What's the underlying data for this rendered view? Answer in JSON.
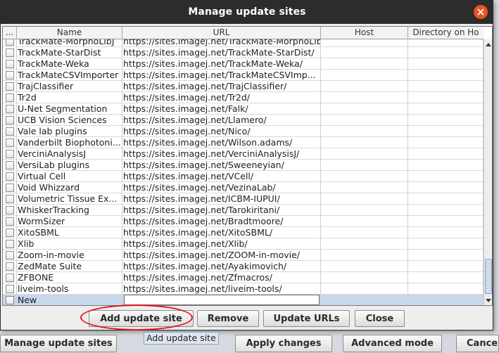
{
  "dialog": {
    "title": "Manage update sites",
    "close_icon": "close-icon"
  },
  "table": {
    "columns": [
      {
        "key": "check",
        "label": "..."
      },
      {
        "key": "name",
        "label": "Name"
      },
      {
        "key": "url",
        "label": "URL"
      },
      {
        "key": "host",
        "label": "Host"
      },
      {
        "key": "dir",
        "label": "Directory on Ho"
      }
    ],
    "rows": [
      {
        "checked": false,
        "name": "TrackMate-MorphoLibJ",
        "url": "https://sites.imagej.net/TrackMate-MorphoLibJ/",
        "host": "",
        "dir": ""
      },
      {
        "checked": false,
        "name": "TrackMate-StarDist",
        "url": "https://sites.imagej.net/TrackMate-StarDist/",
        "host": "",
        "dir": ""
      },
      {
        "checked": false,
        "name": "TrackMate-Weka",
        "url": "https://sites.imagej.net/TrackMate-Weka/",
        "host": "",
        "dir": ""
      },
      {
        "checked": false,
        "name": "TrackMateCSVImporter",
        "url": "https://sites.imagej.net/TrackMateCSVImp...",
        "host": "",
        "dir": ""
      },
      {
        "checked": false,
        "name": "TrajClassifier",
        "url": "https://sites.imagej.net/TrajClassifier/",
        "host": "",
        "dir": ""
      },
      {
        "checked": false,
        "name": "Tr2d",
        "url": "https://sites.imagej.net/Tr2d/",
        "host": "",
        "dir": ""
      },
      {
        "checked": false,
        "name": "U-Net Segmentation",
        "url": "https://sites.imagej.net/Falk/",
        "host": "",
        "dir": ""
      },
      {
        "checked": false,
        "name": "UCB Vision Sciences",
        "url": "https://sites.imagej.net/Llamero/",
        "host": "",
        "dir": ""
      },
      {
        "checked": false,
        "name": "Vale lab plugins",
        "url": "https://sites.imagej.net/Nico/",
        "host": "",
        "dir": ""
      },
      {
        "checked": false,
        "name": "Vanderbilt Biophotoni...",
        "url": "https://sites.imagej.net/Wilson.adams/",
        "host": "",
        "dir": ""
      },
      {
        "checked": false,
        "name": "VerciniAnalysisJ",
        "url": "https://sites.imagej.net/VerciniAnalysisJ/",
        "host": "",
        "dir": ""
      },
      {
        "checked": false,
        "name": "VersiLab plugins",
        "url": "https://sites.imagej.net/Sweeneyian/",
        "host": "",
        "dir": ""
      },
      {
        "checked": false,
        "name": "Virtual Cell",
        "url": "https://sites.imagej.net/VCell/",
        "host": "",
        "dir": ""
      },
      {
        "checked": false,
        "name": "Void Whizzard",
        "url": "https://sites.imagej.net/VezinaLab/",
        "host": "",
        "dir": ""
      },
      {
        "checked": false,
        "name": "Volumetric Tissue Ex...",
        "url": "https://sites.imagej.net/ICBM-IUPUI/",
        "host": "",
        "dir": ""
      },
      {
        "checked": false,
        "name": "WhiskerTracking",
        "url": "https://sites.imagej.net/Tarokiritani/",
        "host": "",
        "dir": ""
      },
      {
        "checked": false,
        "name": "WormSizer",
        "url": "https://sites.imagej.net/Bradtmoore/",
        "host": "",
        "dir": ""
      },
      {
        "checked": false,
        "name": "XitoSBML",
        "url": "https://sites.imagej.net/XitoSBML/",
        "host": "",
        "dir": ""
      },
      {
        "checked": false,
        "name": "Xlib",
        "url": "https://sites.imagej.net/Xlib/",
        "host": "",
        "dir": ""
      },
      {
        "checked": false,
        "name": "Zoom-in-movie",
        "url": "https://sites.imagej.net/ZOOM-in-movie/",
        "host": "",
        "dir": ""
      },
      {
        "checked": false,
        "name": "ZedMate Suite",
        "url": "https://sites.imagej.net/Ayakimovich/",
        "host": "",
        "dir": ""
      },
      {
        "checked": false,
        "name": "ZFBONE",
        "url": "https://sites.imagej.net/Zfmacros/",
        "host": "",
        "dir": ""
      },
      {
        "checked": false,
        "name": "liveim-tools",
        "url": "https://sites.imagej.net/liveim-tools/",
        "host": "",
        "dir": ""
      },
      {
        "checked": false,
        "name": "New",
        "url": "",
        "host": "",
        "dir": "",
        "selected": true,
        "editing_url": true
      }
    ]
  },
  "buttons": {
    "add_update_site": "Add update site",
    "remove": "Remove",
    "update_urls": "Update URLs",
    "close": "Close"
  },
  "tooltip": "Add update site",
  "background_window": {
    "manage_update_sites": "Manage update sites",
    "apply_changes": "Apply changes",
    "advanced_mode": "Advanced mode",
    "cancel": "Cancel"
  },
  "colors": {
    "titlebar": "#2c2c2c",
    "close_button": "#e9541f",
    "selection": "#c6d7ee",
    "annotation": "#e0151c"
  }
}
